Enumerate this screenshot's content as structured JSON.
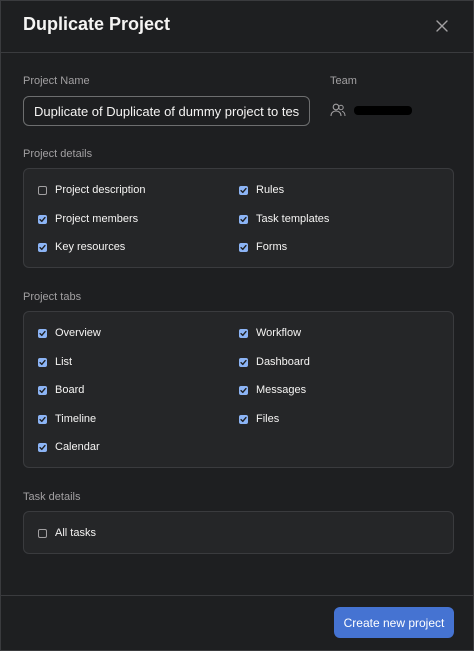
{
  "dialog": {
    "title": "Duplicate Project",
    "close_icon": "close-icon"
  },
  "project_name": {
    "label": "Project Name",
    "value": "Duplicate of Duplicate of dummy project to test bu"
  },
  "team": {
    "label": "Team",
    "icon": "people-icon"
  },
  "project_details": {
    "label": "Project details",
    "items": [
      {
        "label": "Project description",
        "checked": false
      },
      {
        "label": "Rules",
        "checked": true
      },
      {
        "label": "Project members",
        "checked": true
      },
      {
        "label": "Task templates",
        "checked": true
      },
      {
        "label": "Key resources",
        "checked": true
      },
      {
        "label": "Forms",
        "checked": true
      }
    ]
  },
  "project_tabs": {
    "label": "Project tabs",
    "items": [
      {
        "label": "Overview",
        "checked": true
      },
      {
        "label": "Workflow",
        "checked": true
      },
      {
        "label": "List",
        "checked": true
      },
      {
        "label": "Dashboard",
        "checked": true
      },
      {
        "label": "Board",
        "checked": true
      },
      {
        "label": "Messages",
        "checked": true
      },
      {
        "label": "Timeline",
        "checked": true
      },
      {
        "label": "Files",
        "checked": true
      },
      {
        "label": "Calendar",
        "checked": true
      }
    ]
  },
  "task_details": {
    "label": "Task details",
    "items": [
      {
        "label": "All tasks",
        "checked": false
      }
    ]
  },
  "footer": {
    "create_button": "Create new project"
  },
  "colors": {
    "background": "#1e1f21",
    "checkbox_checked": "#8cb4f5",
    "primary_button": "#4573d2"
  }
}
